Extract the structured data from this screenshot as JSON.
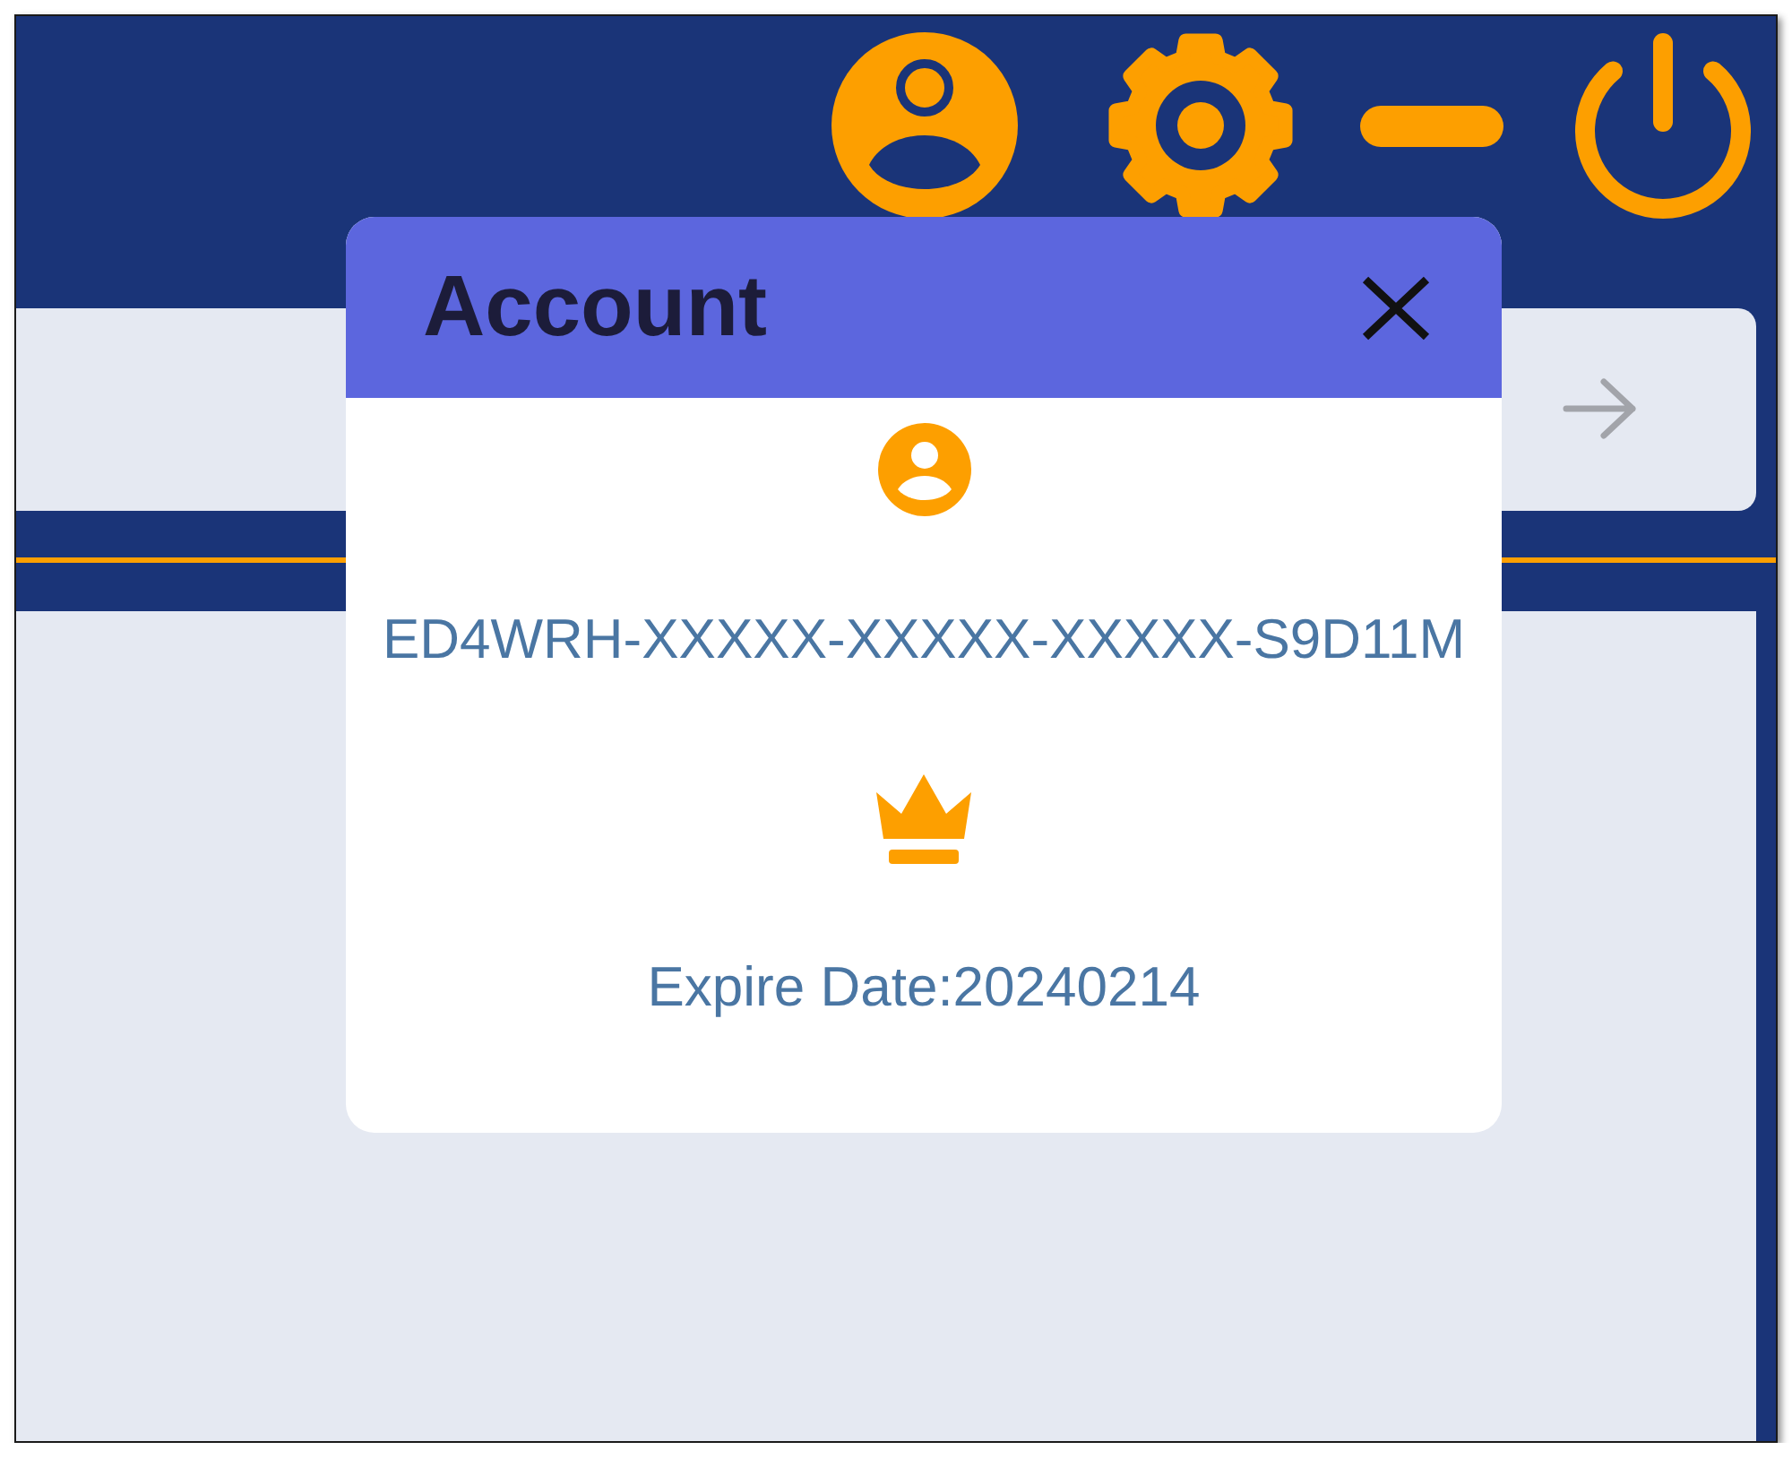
{
  "toolbar": {
    "buttons": [
      {
        "kind": "account"
      },
      {
        "kind": "settings"
      },
      {
        "kind": "minimize"
      },
      {
        "kind": "power"
      }
    ]
  },
  "dialog": {
    "title": "Account",
    "items": [
      {
        "kind": "user",
        "text": "ED4WRH-XXXXX-XXXXX-XXXXX-S9D11M"
      },
      {
        "kind": "premium",
        "text": "Expire Date:20240214"
      }
    ]
  }
}
